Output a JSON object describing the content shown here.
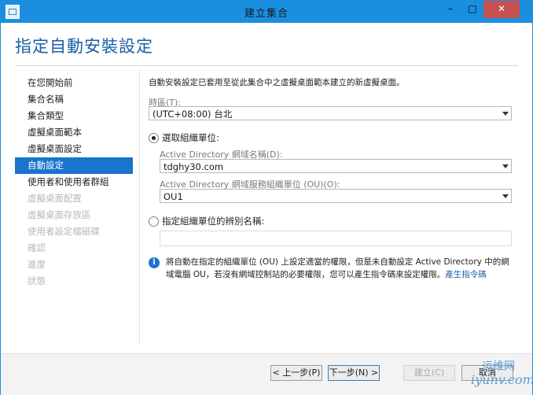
{
  "window": {
    "title": "建立集合",
    "buttons": {
      "minimize": "–",
      "maximize": "□",
      "close": "✕"
    }
  },
  "page": {
    "title": "指定自動安裝設定"
  },
  "nav": {
    "items": [
      {
        "label": "在您開始前"
      },
      {
        "label": "集合名稱"
      },
      {
        "label": "集合類型"
      },
      {
        "label": "虛擬桌面範本"
      },
      {
        "label": "虛擬桌面設定"
      },
      {
        "label": "自動設定"
      },
      {
        "label": "使用者和使用者群組"
      },
      {
        "label": "虛擬桌面配置"
      },
      {
        "label": "虛擬桌面存放區"
      },
      {
        "label": "使用者設定檔磁碟"
      },
      {
        "label": "確認"
      },
      {
        "label": "進度"
      },
      {
        "label": "狀態"
      }
    ],
    "active_index": 5,
    "disabled_from_index": 7
  },
  "content": {
    "description": "自動安裝設定已套用至從此集合中之虛擬桌面範本建立的新虛擬桌面。",
    "timezone": {
      "label": "時區(T):",
      "value": "(UTC+08:00) 台北"
    },
    "ou_radio": {
      "label": "選取組織單位:",
      "checked": true
    },
    "ad_domain": {
      "label": "Active Directory 網域名稱(D):",
      "value": "tdghy30.com"
    },
    "ad_ou": {
      "label": "Active Directory 網域服務組織單位 (OU)(O):",
      "value": "OU1"
    },
    "dn_radio": {
      "label": "指定組織單位的辨別名稱:",
      "checked": false
    },
    "dn_input": {
      "value": ""
    },
    "info": {
      "text": "將自動在指定的組織單位 (OU) 上設定適當的權限，但是未自動設定 Active Directory 中的網域電腦 OU，若沒有網域控制站的必要權限，您可以產生指令碼來設定權限。",
      "link": "產生指令碼"
    }
  },
  "buttons": {
    "prev": "< 上一步(P)",
    "next": "下一步(N) >",
    "create": "建立(C)",
    "cancel": "取消"
  },
  "watermark": {
    "top": "运维网",
    "bottom": "iyunv.com"
  }
}
